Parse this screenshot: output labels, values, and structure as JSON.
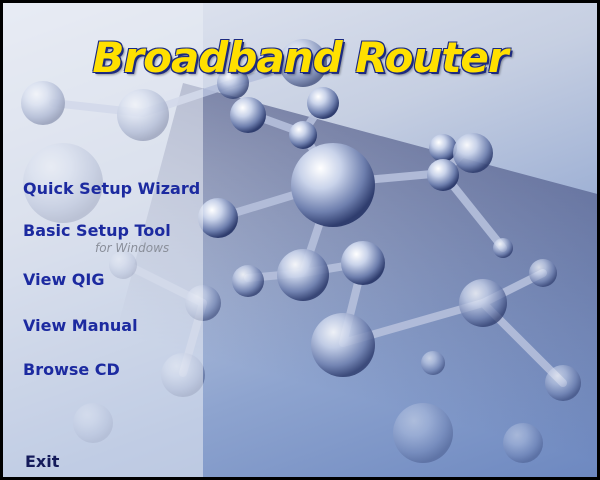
{
  "window": {
    "title": "Broadband Router"
  },
  "menu": {
    "quick_setup": "Quick Setup Wizard",
    "basic_setup": "Basic Setup Tool",
    "basic_setup_note": "for Windows",
    "view_qig": "View QIG",
    "view_manual": "View Manual",
    "browse_cd": "Browse CD",
    "exit": "Exit"
  },
  "colors": {
    "title_fill": "#ffe000",
    "title_outline": "#1c2a80",
    "menu_text": "#1c2aa0",
    "note_text": "#8a8f9a"
  }
}
